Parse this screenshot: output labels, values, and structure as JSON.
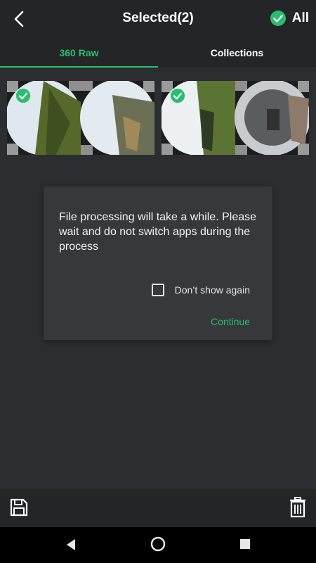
{
  "header": {
    "title": "Selected(2)",
    "select_all_label": "All",
    "icons": {
      "back": "chevron-left-icon",
      "select_all": "check-circle-icon"
    }
  },
  "tabs": [
    {
      "label": "360 Raw",
      "active": true
    },
    {
      "label": "Collections",
      "active": false
    }
  ],
  "thumbnails": [
    {
      "selected": true,
      "icon": "check-circle-icon"
    },
    {
      "selected": true,
      "icon": "check-circle-icon"
    }
  ],
  "dialog": {
    "message": "File processing will take a while. Please wait and do not switch apps during the process",
    "checkbox_label": "Don’t show again",
    "checkbox_checked": false,
    "continue_label": "Continue"
  },
  "bottom_bar": {
    "icons": {
      "save": "save-icon",
      "delete": "trash-icon"
    }
  },
  "nav_bar": {
    "icons": {
      "back": "triangle-back-icon",
      "home": "circle-home-icon",
      "recents": "square-recents-icon"
    }
  },
  "colors": {
    "accent": "#2bbd6e",
    "background": "#2b2d30",
    "bar": "#232527",
    "dialog": "#36383b"
  }
}
